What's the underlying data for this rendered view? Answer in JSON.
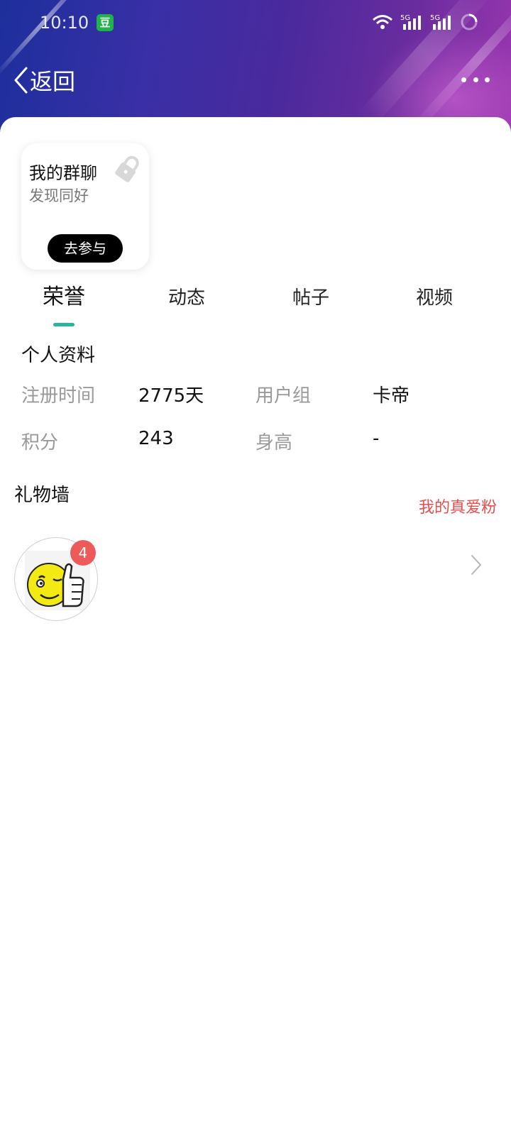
{
  "status_bar": {
    "time": "10:10",
    "app_badge": "豆",
    "network_1": "5G",
    "network_2": "5G"
  },
  "nav": {
    "back_label": "返回",
    "more_icon": "more-dots-icon"
  },
  "group_card": {
    "title": "我的群聊",
    "subtitle": "发现同好",
    "button_label": "去参与"
  },
  "tabs": [
    {
      "label": "荣誉",
      "active": true
    },
    {
      "label": "动态",
      "active": false
    },
    {
      "label": "帖子",
      "active": false
    },
    {
      "label": "视频",
      "active": false
    }
  ],
  "profile": {
    "section_title": "个人资料",
    "rows": [
      {
        "label1": "注册时间",
        "value1": "2775天",
        "label2": "用户组",
        "value2": "卡帝"
      },
      {
        "label1": "积分",
        "value1": "243",
        "label2": "身高",
        "value2": "-"
      }
    ]
  },
  "gift_wall": {
    "title": "礼物墙",
    "link_label": "我的真爱粉",
    "gift_count": "4"
  },
  "colors": {
    "accent": "#28b59b",
    "link_red": "#e64d4d",
    "badge_red": "#ec5a5a"
  }
}
